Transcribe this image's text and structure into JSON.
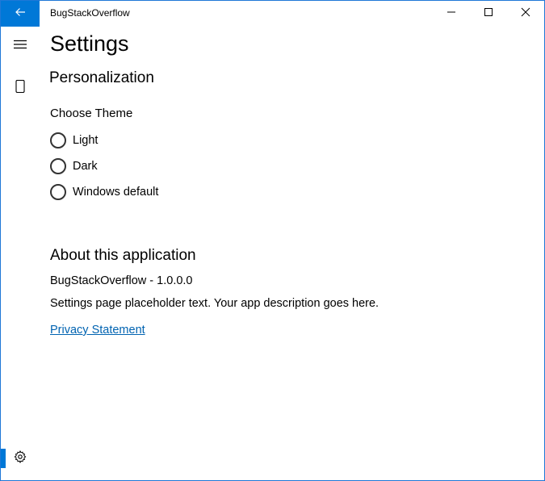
{
  "window": {
    "title": "BugStackOverflow"
  },
  "icons": {
    "back": "back-arrow-icon",
    "minimize": "minimize-icon",
    "maximize": "maximize-icon",
    "close": "close-icon",
    "hamburger": "hamburger-icon",
    "device": "device-icon",
    "settings": "gear-icon"
  },
  "colors": {
    "accent": "#0078d7",
    "link": "#0063b1",
    "border": "#1e78d7"
  },
  "page": {
    "title": "Settings",
    "personalization_header": "Personalization",
    "choose_theme_label": "Choose Theme",
    "theme_options": [
      {
        "label": "Light",
        "selected": false
      },
      {
        "label": "Dark",
        "selected": false
      },
      {
        "label": "Windows default",
        "selected": false
      }
    ],
    "about_header": "About this application",
    "version_text": "BugStackOverflow - 1.0.0.0",
    "description_text": "Settings page placeholder text.  Your app description goes here.",
    "privacy_link": "Privacy Statement"
  }
}
